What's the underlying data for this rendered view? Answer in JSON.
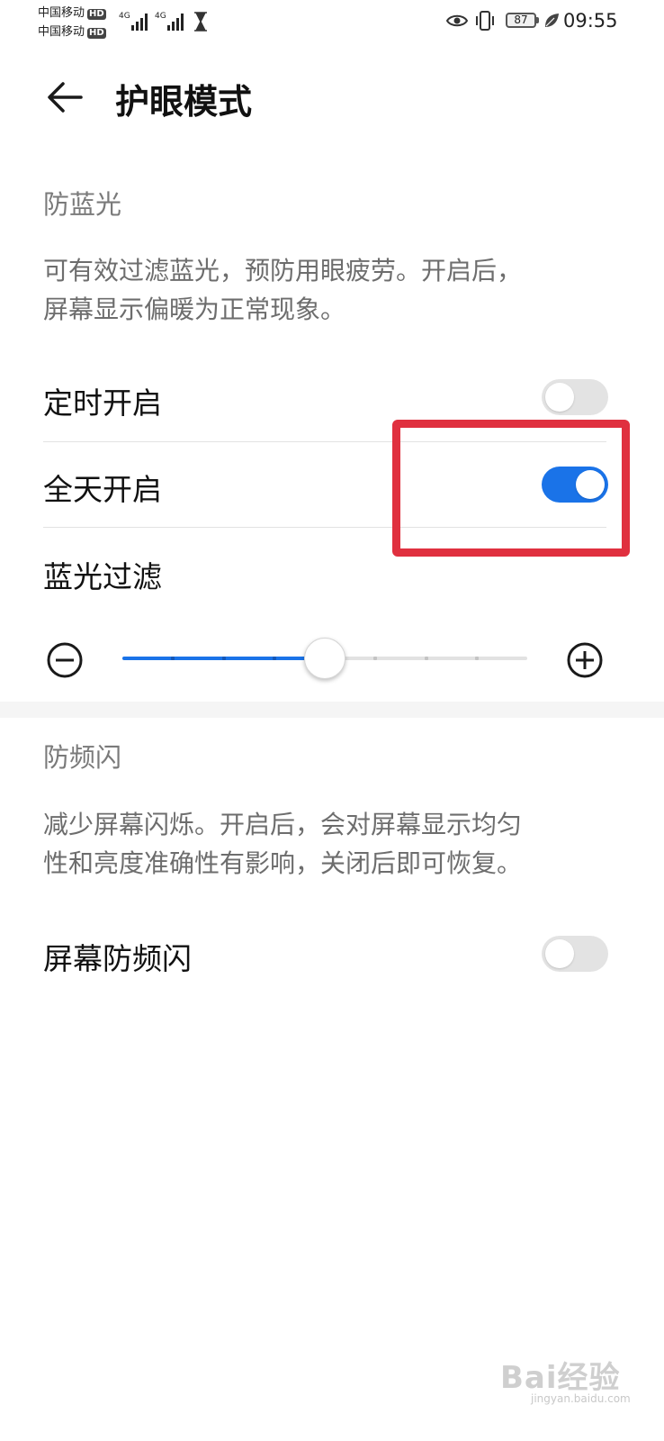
{
  "status_bar": {
    "carrier1": "中国移动",
    "carrier2": "中国移动",
    "hd_label": "HD",
    "network1": "4G",
    "network2": "4G",
    "battery": "87",
    "time": "09:55",
    "icons": [
      "signal-icon",
      "hourglass-icon",
      "eye-icon",
      "vibrate-icon",
      "battery-icon",
      "leaf-icon"
    ]
  },
  "header": {
    "title": "护眼模式",
    "back_icon": "back-arrow-icon"
  },
  "blue_light": {
    "section_title": "防蓝光",
    "description_line1": "可有效过滤蓝光，预防用眼疲劳。开启后，",
    "description_line2": "屏幕显示偏暖为正常现象。",
    "scheduled": {
      "label": "定时开启",
      "enabled": false
    },
    "all_day": {
      "label": "全天开启",
      "enabled": true
    },
    "filter": {
      "label": "蓝光过滤",
      "value_fraction": 0.5,
      "steps": 8,
      "minus_icon": "minus-circle-icon",
      "plus_icon": "plus-circle-icon"
    }
  },
  "flicker": {
    "section_title": "防频闪",
    "description_line1": "减少屏幕闪烁。开启后，会对屏幕显示均匀",
    "description_line2": "性和亮度准确性有影响，关闭后即可恢复。",
    "screen_flicker": {
      "label": "屏幕防频闪",
      "enabled": false
    }
  },
  "annotation": {
    "color": "#e0303f"
  },
  "colors": {
    "accent": "#1a73e8"
  },
  "watermark": {
    "main": "Bai经验",
    "sub": "jingyan.baidu.com"
  }
}
